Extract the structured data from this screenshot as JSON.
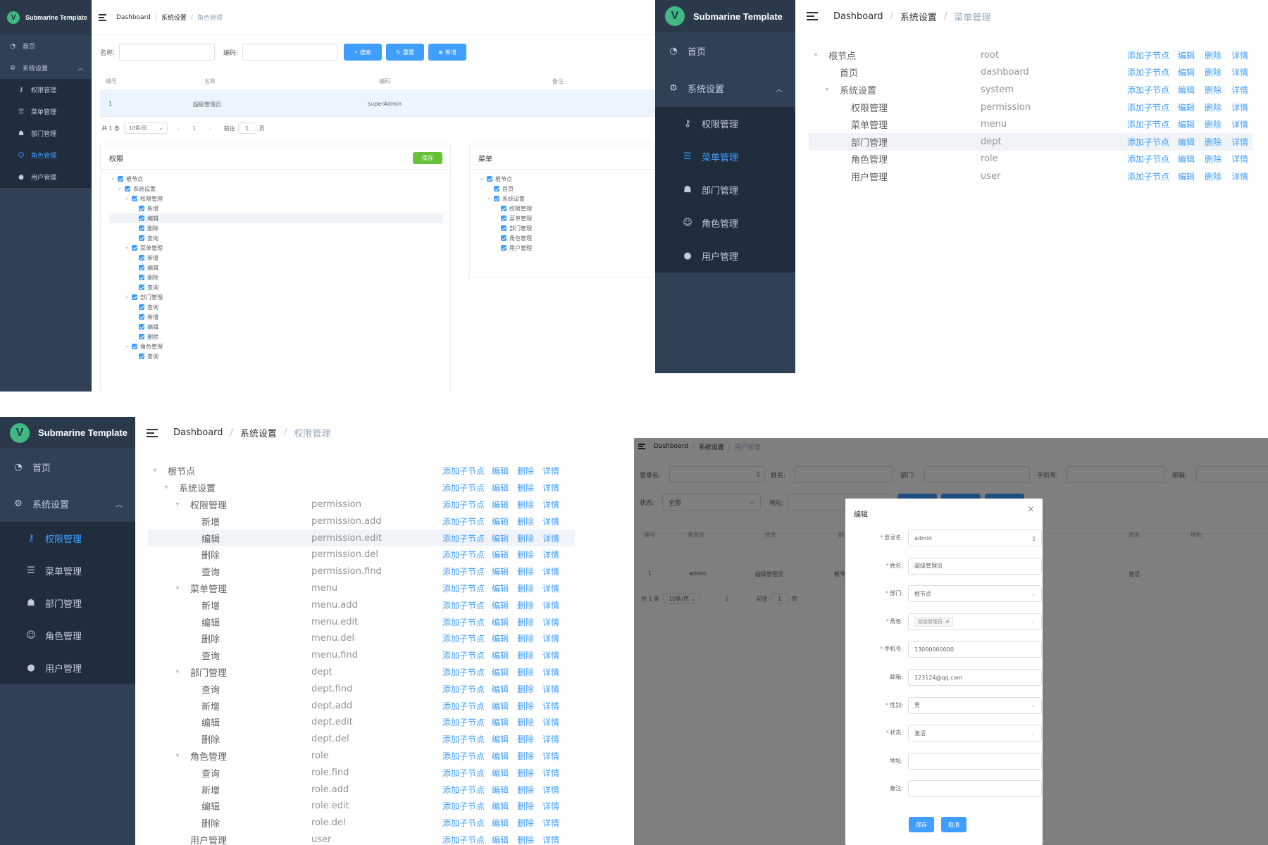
{
  "app": {
    "title": "Submarine Template",
    "logo_letter": "V"
  },
  "menu": {
    "home": "首页",
    "system": "系统设置",
    "items": [
      "权限管理",
      "菜单管理",
      "部门管理",
      "角色管理",
      "用户管理"
    ]
  },
  "breadcrumb": {
    "root": "Dashboard",
    "section": "系统设置",
    "role": "角色管理",
    "menu": "菜单管理",
    "permission": "权限管理",
    "user": "用户管理"
  },
  "role_page": {
    "search": {
      "name_label": "名称:",
      "code_label": "编码:",
      "search_btn": "搜索",
      "reset_btn": "重置",
      "add_btn": "新增"
    },
    "table": {
      "headers": [
        "编号",
        "名称",
        "编码",
        "备注"
      ],
      "rows": [
        [
          "1",
          "超级管理员",
          "superAdmin",
          ""
        ]
      ]
    },
    "pager": {
      "total": "共 1 条",
      "size": "10条/页",
      "page": "1",
      "goto": "前往",
      "goto_value": "1",
      "page_suffix": "页"
    },
    "perm_panel": {
      "title": "权限",
      "save": "保存"
    },
    "menu_panel": {
      "title": "菜单"
    },
    "perm_tree": [
      {
        "level": 0,
        "label": "根节点"
      },
      {
        "level": 1,
        "label": "系统设置"
      },
      {
        "level": 2,
        "label": "权限管理"
      },
      {
        "level": 3,
        "label": "新增"
      },
      {
        "level": 3,
        "label": "编辑"
      },
      {
        "level": 3,
        "label": "删除"
      },
      {
        "level": 3,
        "label": "查询"
      },
      {
        "level": 2,
        "label": "菜单管理"
      },
      {
        "level": 3,
        "label": "新增"
      },
      {
        "level": 3,
        "label": "编辑"
      },
      {
        "level": 3,
        "label": "删除"
      },
      {
        "level": 3,
        "label": "查询"
      },
      {
        "level": 2,
        "label": "部门管理"
      },
      {
        "level": 3,
        "label": "查询"
      },
      {
        "level": 3,
        "label": "新增"
      },
      {
        "level": 3,
        "label": "编辑"
      },
      {
        "level": 3,
        "label": "删除"
      },
      {
        "level": 2,
        "label": "角色管理"
      },
      {
        "level": 3,
        "label": "查询"
      }
    ],
    "menu_tree": [
      {
        "level": 0,
        "label": "根节点"
      },
      {
        "level": 1,
        "label": "首页"
      },
      {
        "level": 1,
        "label": "系统设置"
      },
      {
        "level": 2,
        "label": "权限管理"
      },
      {
        "level": 2,
        "label": "菜单管理"
      },
      {
        "level": 2,
        "label": "部门管理"
      },
      {
        "level": 2,
        "label": "角色管理"
      },
      {
        "level": 2,
        "label": "用户管理"
      }
    ]
  },
  "actions": {
    "add_child": "添加子节点",
    "edit": "编辑",
    "delete": "删除",
    "detail": "详情"
  },
  "menu_page": {
    "rows": [
      {
        "level": 0,
        "label": "根节点",
        "code": "root"
      },
      {
        "level": 1,
        "label": "首页",
        "code": "dashboard"
      },
      {
        "level": 1,
        "label": "系统设置",
        "code": "system"
      },
      {
        "level": 2,
        "label": "权限管理",
        "code": "permission"
      },
      {
        "level": 2,
        "label": "菜单管理",
        "code": "menu"
      },
      {
        "level": 2,
        "label": "部门管理",
        "code": "dept"
      },
      {
        "level": 2,
        "label": "角色管理",
        "code": "role"
      },
      {
        "level": 2,
        "label": "用户管理",
        "code": "user"
      }
    ]
  },
  "perm_page": {
    "rows": [
      {
        "level": 0,
        "label": "根节点",
        "code": ""
      },
      {
        "level": 1,
        "label": "系统设置",
        "code": ""
      },
      {
        "level": 2,
        "label": "权限管理",
        "code": "permission"
      },
      {
        "level": 3,
        "label": "新增",
        "code": "permission.add"
      },
      {
        "level": 3,
        "label": "编辑",
        "code": "permission.edit"
      },
      {
        "level": 3,
        "label": "删除",
        "code": "permission.del"
      },
      {
        "level": 3,
        "label": "查询",
        "code": "permission.find"
      },
      {
        "level": 2,
        "label": "菜单管理",
        "code": "menu"
      },
      {
        "level": 3,
        "label": "新增",
        "code": "menu.add"
      },
      {
        "level": 3,
        "label": "编辑",
        "code": "menu.edit"
      },
      {
        "level": 3,
        "label": "删除",
        "code": "menu.del"
      },
      {
        "level": 3,
        "label": "查询",
        "code": "menu.find"
      },
      {
        "level": 2,
        "label": "部门管理",
        "code": "dept"
      },
      {
        "level": 3,
        "label": "查询",
        "code": "dept.find"
      },
      {
        "level": 3,
        "label": "新增",
        "code": "dept.add"
      },
      {
        "level": 3,
        "label": "编辑",
        "code": "dept.edit"
      },
      {
        "level": 3,
        "label": "删除",
        "code": "dept.del"
      },
      {
        "level": 2,
        "label": "角色管理",
        "code": "role"
      },
      {
        "level": 3,
        "label": "查询",
        "code": "role.find"
      },
      {
        "level": 3,
        "label": "新增",
        "code": "role.add"
      },
      {
        "level": 3,
        "label": "编辑",
        "code": "role.edit"
      },
      {
        "level": 3,
        "label": "删除",
        "code": "role.del"
      },
      {
        "level": 2,
        "label": "用户管理",
        "code": "user"
      }
    ]
  },
  "user_page": {
    "search": {
      "login_label": "登录名:",
      "name_label": "姓名:",
      "dept_label": "部门:",
      "phone_label": "手机号:",
      "email_label": "邮箱:",
      "status_label": "状态:",
      "status_value": "全部",
      "address_label": "地址:"
    },
    "table": {
      "headers": [
        "编号",
        "登录名",
        "姓名",
        "部",
        "状态",
        "地址"
      ],
      "row": [
        "1",
        "admin",
        "超级管理员",
        "根节",
        "激活",
        ""
      ]
    },
    "pager": {
      "total": "共 1 条",
      "size": "10条/页",
      "page": "1",
      "goto": "前往",
      "goto_value": "1",
      "page_suffix": "页"
    },
    "dialog": {
      "title": "编辑",
      "close": "×",
      "fields": [
        {
          "label": "登录名:",
          "value": "admin",
          "required": true,
          "kind": "text-icon"
        },
        {
          "label": "姓名:",
          "value": "超级管理员",
          "required": true,
          "kind": "text"
        },
        {
          "label": "部门:",
          "value": "根节点",
          "required": true,
          "kind": "select"
        },
        {
          "label": "角色:",
          "value": "超级管理员",
          "required": true,
          "kind": "tag"
        },
        {
          "label": "手机号:",
          "value": "13000000000",
          "required": true,
          "kind": "text"
        },
        {
          "label": "邮箱:",
          "value": "123124@qq.com",
          "required": false,
          "kind": "text"
        },
        {
          "label": "性别:",
          "value": "男",
          "required": true,
          "kind": "select"
        },
        {
          "label": "状态:",
          "value": "激活",
          "required": true,
          "kind": "select"
        },
        {
          "label": "地址:",
          "value": "",
          "required": false,
          "kind": "text"
        },
        {
          "label": "备注:",
          "value": "",
          "required": false,
          "kind": "text"
        }
      ],
      "save": "保存",
      "cancel": "取消"
    }
  }
}
